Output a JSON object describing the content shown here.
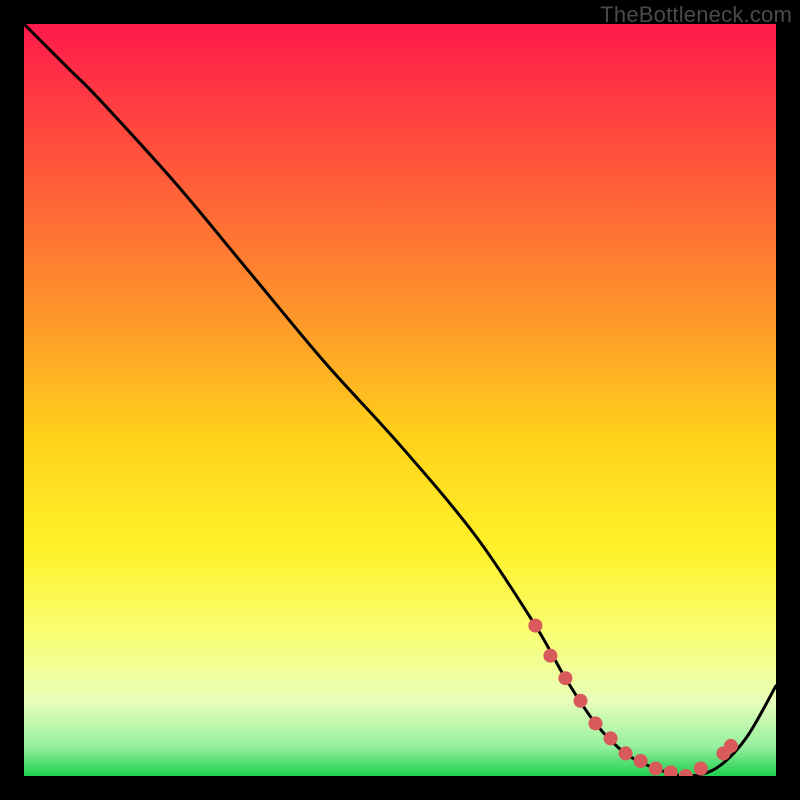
{
  "watermark": "TheBottleneck.com",
  "chart_data": {
    "type": "line",
    "title": "",
    "xlabel": "",
    "ylabel": "",
    "xlim": [
      0,
      100
    ],
    "ylim": [
      0,
      100
    ],
    "series": [
      {
        "name": "curve",
        "x": [
          0,
          6,
          10,
          20,
          30,
          40,
          50,
          60,
          68,
          72,
          76,
          80,
          84,
          88,
          92,
          96,
          100
        ],
        "y": [
          100,
          94,
          90,
          79,
          67,
          55,
          44,
          32,
          20,
          13,
          7,
          3,
          1,
          0,
          1,
          5,
          12
        ]
      }
    ],
    "gradient_stops": [
      {
        "offset": 0,
        "color": "#ff1a4b"
      },
      {
        "offset": 0.2,
        "color": "#ff5a3a"
      },
      {
        "offset": 0.4,
        "color": "#ff9a2a"
      },
      {
        "offset": 0.55,
        "color": "#ffd21a"
      },
      {
        "offset": 0.7,
        "color": "#fff22a"
      },
      {
        "offset": 0.82,
        "color": "#f8ff7a"
      },
      {
        "offset": 0.9,
        "color": "#e8ffba"
      },
      {
        "offset": 0.96,
        "color": "#98f0a0"
      },
      {
        "offset": 1.0,
        "color": "#1fd04f"
      }
    ],
    "markers": {
      "name": "highlighted-points",
      "color": "#d85a5a",
      "radius": 7,
      "points_x": [
        68,
        70,
        72,
        74,
        76,
        78,
        80,
        82,
        84,
        86,
        88,
        90,
        93,
        94
      ],
      "points_y": [
        20,
        16,
        13,
        10,
        7,
        5,
        3,
        2,
        1,
        0.5,
        0,
        1,
        3,
        4
      ]
    }
  }
}
